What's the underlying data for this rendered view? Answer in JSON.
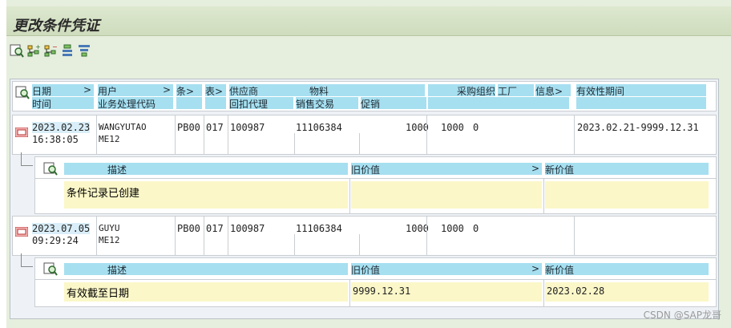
{
  "window": {
    "title": "更改条件凭证"
  },
  "toolbar": {
    "buttons": [
      "details-icon",
      "expand-all-icon",
      "collapse-all-icon",
      "sort-icon",
      "filter-icon"
    ]
  },
  "header": {
    "row1": {
      "date": "日期",
      "user": "用户",
      "cond": "条>",
      "table": "表>",
      "vendor": "供应商",
      "material": "物料",
      "purch_org": "采购组织",
      "plant": "工厂",
      "info": "信息>",
      "validity": "有效性期间"
    },
    "row2": {
      "time": "时间",
      "tcode": "业务处理代码",
      "rebate": "回扣代理",
      "sales": "销售交易",
      "promo": "促销"
    }
  },
  "records": [
    {
      "date": "2023.02.23",
      "time": "16:38:05",
      "user": "WANGYUTAO",
      "tcode": "ME12",
      "cond": "PB00",
      "table": "017",
      "vendor": "100987",
      "material": "11106384",
      "info": "1000",
      "purch_org": "1000",
      "plant": "0",
      "validity": "2023.02.21-9999.12.31",
      "detail_header": {
        "desc": "描述",
        "old": "旧价值",
        "new": "新价值"
      },
      "detail": {
        "desc": "条件记录已创建",
        "old": "",
        "new": ""
      }
    },
    {
      "date": "2023.07.05",
      "time": "09:29:24",
      "user": "GUYU",
      "tcode": "ME12",
      "cond": "PB00",
      "table": "017",
      "vendor": "100987",
      "material": "11106384",
      "info": "1000",
      "purch_org": "1000",
      "plant": "0",
      "validity": "",
      "detail_header": {
        "desc": "描述",
        "old": "旧价值",
        "new": "新价值"
      },
      "detail": {
        "desc": "有效截至日期",
        "old": "9999.12.31",
        "new": "2023.02.28"
      }
    }
  ],
  "watermark": "CSDN @SAP龙哥"
}
